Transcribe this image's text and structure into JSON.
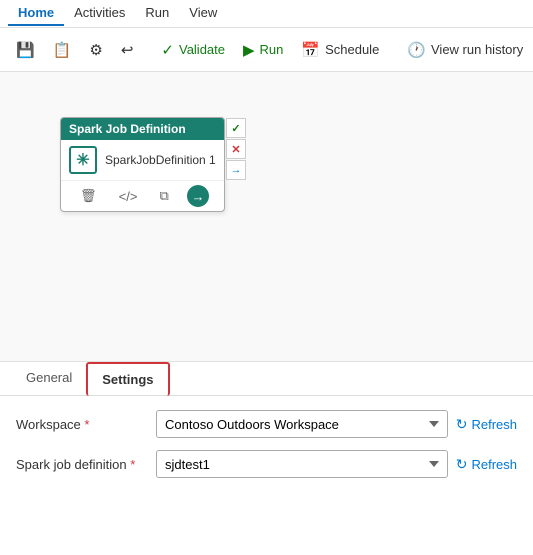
{
  "menuBar": {
    "items": [
      {
        "label": "Home",
        "active": true
      },
      {
        "label": "Activities",
        "active": false
      },
      {
        "label": "Run",
        "active": false
      },
      {
        "label": "View",
        "active": false
      }
    ]
  },
  "toolbar": {
    "saveLabel": "",
    "copyLabel": "",
    "settingsLabel": "",
    "undoLabel": "",
    "validateLabel": "Validate",
    "runLabel": "Run",
    "scheduleLabel": "Schedule",
    "viewRunHistoryLabel": "View run history"
  },
  "canvas": {
    "sparkNode": {
      "headerLabel": "Spark Job Definition",
      "name": "SparkJobDefinition 1",
      "sideBtns": [
        "✓",
        "✕",
        "→"
      ]
    }
  },
  "bottomPanel": {
    "tabs": [
      {
        "label": "General",
        "active": false
      },
      {
        "label": "Settings",
        "active": true
      }
    ],
    "formRows": [
      {
        "label": "Workspace",
        "required": true,
        "selectValue": "Contoso Outdoors Workspace",
        "refreshLabel": "Refresh"
      },
      {
        "label": "Spark job definition",
        "required": true,
        "selectValue": "sjdtest1",
        "refreshLabel": "Refresh"
      }
    ]
  }
}
